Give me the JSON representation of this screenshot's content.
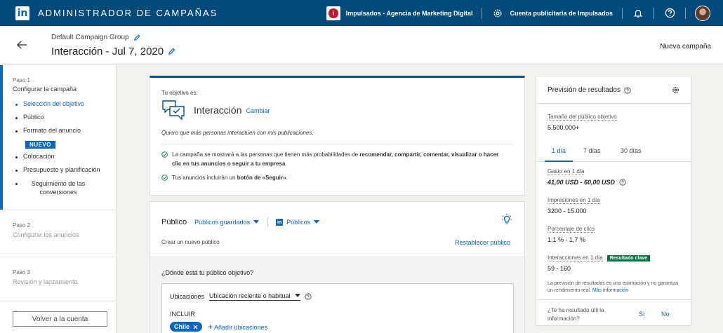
{
  "topbar": {
    "logo_text": "in",
    "title": "ADMINISTRADOR DE CAMPAÑAS",
    "account_logo_glyph": "i",
    "account_name": "Impulsados - Agencia de Marketing Digital",
    "ad_account": "Cuenta publicitaria de Impulsados",
    "icons": [
      "gear-icon",
      "bell-icon",
      "help-icon",
      "avatar"
    ]
  },
  "header": {
    "group_name": "Default Campaign Group",
    "campaign_name": "Interacción - Jul 7, 2020",
    "new_campaign": "Nueva campaña"
  },
  "sidebar": {
    "step1": {
      "label": "Paso 1",
      "title": "Configurar la campaña",
      "items": [
        {
          "label": "Selección del objetivo"
        },
        {
          "label": "Público"
        },
        {
          "label": "Formato del anuncio"
        },
        {
          "label": "Colocación"
        },
        {
          "label": "Presupuesto y planificación"
        },
        {
          "label": "Seguimiento de las conversiones"
        }
      ],
      "badge": "NUEVO"
    },
    "step2": {
      "label": "Paso 2",
      "title": "Configurar los anuncios"
    },
    "step3": {
      "label": "Paso 3",
      "title": "Revisión y lanzamiento"
    },
    "back_button": "Volver a la cuenta"
  },
  "objective": {
    "label": "Tu objetivo es:",
    "name": "Interacción",
    "change": "Cambiar",
    "description": "Quiero que más personas interactúen con mis publicaciones.",
    "check1": {
      "a": "La campaña se mostrará a las personas que tienen más probabilidades de ",
      "b": "recomendar, compartir, comentar, visualizar o hacer clic en tus anuncios o seguir a tu empresa",
      "c": "."
    },
    "check2": {
      "a": "Tus anuncios incluirán un ",
      "b": "botón de «Seguir»",
      "c": "."
    }
  },
  "audience": {
    "title": "Público",
    "saved": "Públicos guardados",
    "linkedin": "Públicos",
    "create": "Crear un nuevo público",
    "reset": "Restablecer público",
    "where_question": "¿Dónde está tu público objetivo?",
    "locations_label": "Ubicaciones",
    "location_type": "Ubicación reciente o habitual",
    "include": "INCLUIR",
    "chip": "Chile",
    "add_locations": "Añadir ubicaciones"
  },
  "forecast": {
    "title": "Previsión de resultados",
    "audience_size_label": "Tamaño del público objetivo",
    "audience_size": "5.500.000+",
    "tabs": [
      "1 día",
      "7 días",
      "30 días"
    ],
    "spend_label": "Gasto en 1 día",
    "spend": "41,00 USD - 60,00 USD",
    "impressions_label": "Impresiones en 1 día",
    "impressions": "3200 - 15.000",
    "ctr_label": "Porcentaje de clics",
    "ctr": "1,1 % - 1,7 %",
    "interactions_label": "Interacciones en 1 día",
    "key_badge": "Resultado clave",
    "interactions": "59 - 160",
    "note": "La previsión de resultados es una estimación y no garantiza un rendimiento real. ",
    "note_link": "Más información",
    "question": "¿Te ha resultado útil la información?",
    "yes": "Sí",
    "no": "No"
  },
  "colors": {
    "topbar": "#004b7c",
    "accent": "#0a66c2",
    "key_badge": "#057642"
  }
}
